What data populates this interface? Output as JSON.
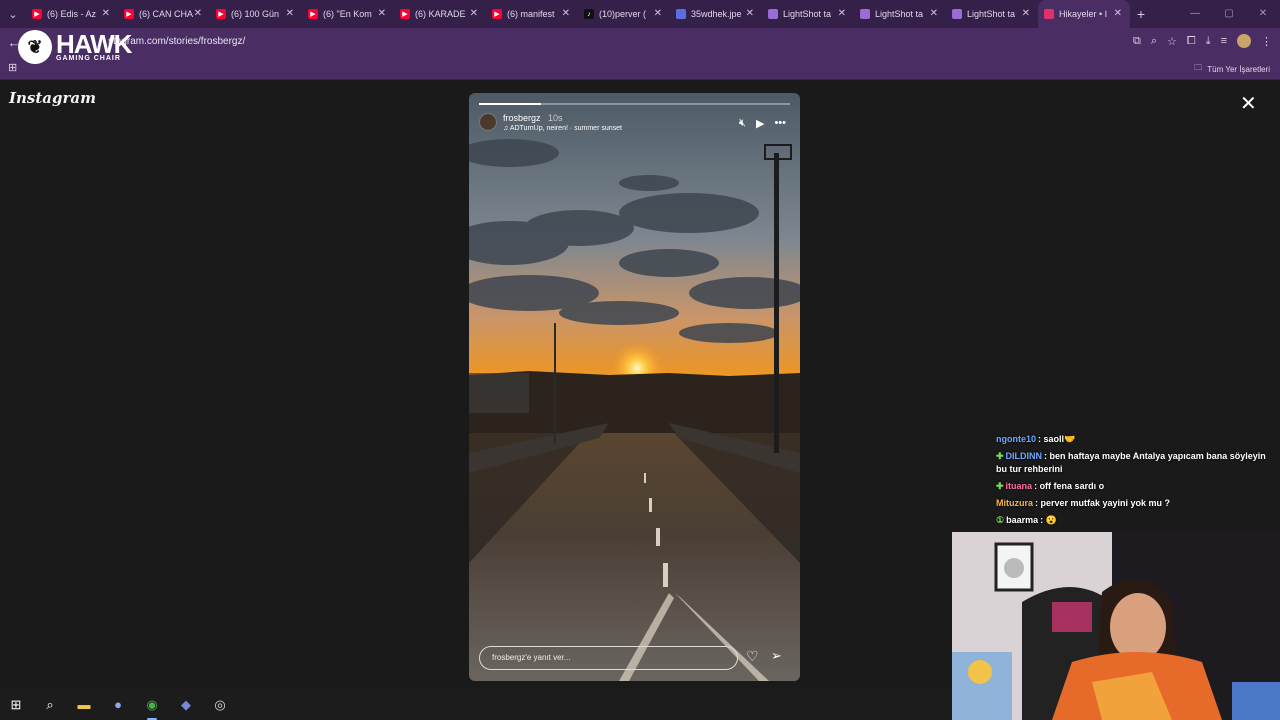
{
  "browser": {
    "tabs": [
      {
        "title": "(6) Edis - Az",
        "icon": "youtube-icon",
        "color": "#ff0033"
      },
      {
        "title": "(6) CAN CHA",
        "icon": "youtube-icon",
        "color": "#ff0033"
      },
      {
        "title": "(6) 100 Gün",
        "icon": "youtube-icon",
        "color": "#ff0033"
      },
      {
        "title": "(6) \"En Kom",
        "icon": "youtube-icon",
        "color": "#ff0033"
      },
      {
        "title": "(6) KARADE",
        "icon": "youtube-icon",
        "color": "#ff0033"
      },
      {
        "title": "(6) manifest",
        "icon": "youtube-icon",
        "color": "#ff0033"
      },
      {
        "title": "(10)perver (",
        "icon": "tiktok-icon",
        "color": "#111111"
      },
      {
        "title": "35wdhek.jpe",
        "icon": "image-icon",
        "color": "#5b6ee1"
      },
      {
        "title": "LightShot ta",
        "icon": "lightshot-icon",
        "color": "#9b6bd6"
      },
      {
        "title": "LightShot ta",
        "icon": "lightshot-icon",
        "color": "#9b6bd6"
      },
      {
        "title": "LightShot ta",
        "icon": "lightshot-icon",
        "color": "#9b6bd6"
      },
      {
        "title": "Hikayeler • I",
        "icon": "instagram-icon",
        "color": "#e1306c"
      }
    ],
    "url": "stagram.com/stories/frosbergz/",
    "bookmarks_all": "Tüm Yer İşaretleri"
  },
  "overlay": {
    "brand": "HAWK",
    "brand_sub": "GAMING CHAIR"
  },
  "instagram": {
    "logo": "Instagram",
    "story": {
      "username": "frosbergz",
      "time": "10s",
      "music": "ADTurnUp, neiren! · summer sunset",
      "reply_placeholder": "frosbergz'e yanıt ver...",
      "progress_fraction": 0.2
    }
  },
  "chat": [
    {
      "badge": "",
      "name": "ngonte10",
      "name_color": "#6fa8ff",
      "message": "saoll🤝"
    },
    {
      "badge": "✚",
      "name": "DILDINN",
      "name_color": "#6fa8ff",
      "message": "ben haftaya maybe Antalya yapıcam bana söyleyin bu tur rehberini"
    },
    {
      "badge": "✚",
      "name": "ituana",
      "name_color": "#ff6fa8",
      "message": "off fena sardı o"
    },
    {
      "badge": "",
      "name": "Mituzura",
      "name_color": "#ffb347",
      "message": "perver mutfak yayini yok mu ?"
    },
    {
      "badge": "①",
      "name": "baarma",
      "name_color": "#ffffff",
      "message": "😮"
    }
  ]
}
